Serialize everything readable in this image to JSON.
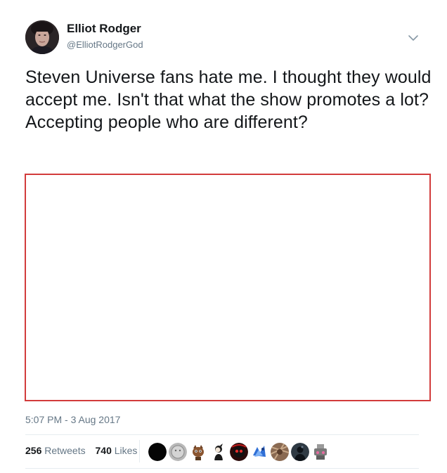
{
  "author": {
    "name": "Elliot Rodger",
    "handle": "@ElliotRodgerGod"
  },
  "tweet": {
    "text": "Steven Universe fans hate me. I thought they would accept me. Isn't that what the show promotes a lot? Accepting people who are different?",
    "timestamp": "5:07 PM - 3 Aug 2017"
  },
  "stats": {
    "retweets_count": "256",
    "retweets_label": "Retweets",
    "likes_count": "740",
    "likes_label": "Likes"
  },
  "likers": [
    {
      "icon": "black-circle-avatar"
    },
    {
      "icon": "gray-face-avatar"
    },
    {
      "icon": "brown-cat-avatar"
    },
    {
      "icon": "cartoon-figure-avatar"
    },
    {
      "icon": "red-eye-character-avatar"
    },
    {
      "icon": "blue-splash-avatar"
    },
    {
      "icon": "brown-texture-avatar"
    },
    {
      "icon": "dark-figure-avatar"
    },
    {
      "icon": "gray-pink-avatar"
    }
  ],
  "colors": {
    "text_primary": "#14171a",
    "text_secondary": "#657786",
    "divider": "#e6ecf0",
    "media_border": "#d23b3b"
  }
}
